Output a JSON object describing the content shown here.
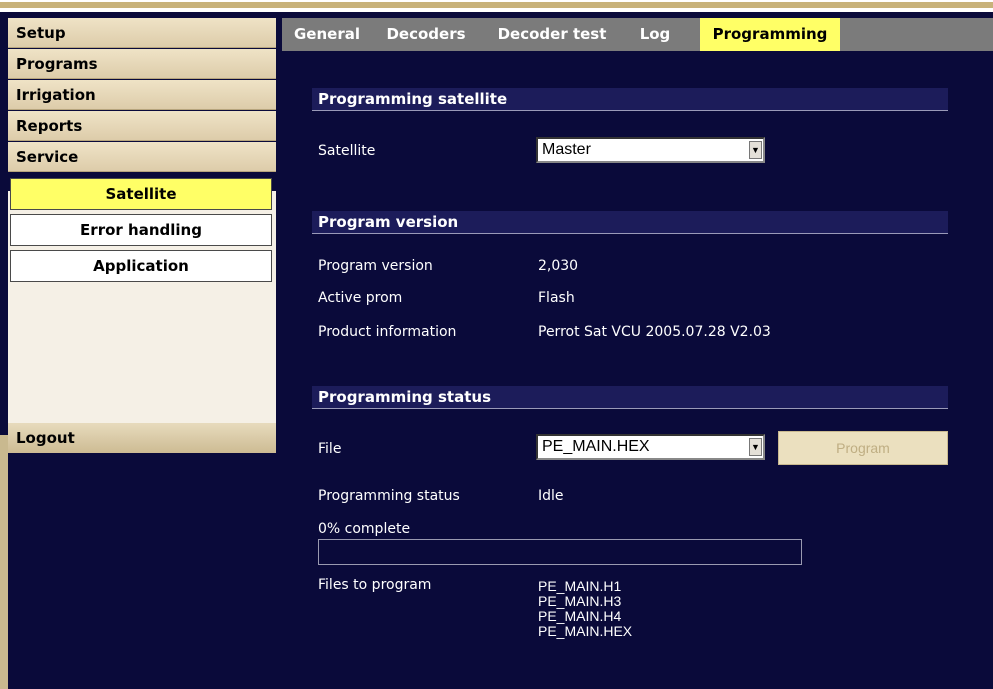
{
  "nav": {
    "main": [
      "Setup",
      "Programs",
      "Irrigation",
      "Reports",
      "Service"
    ],
    "sub": [
      {
        "label": "Satellite",
        "active": true
      },
      {
        "label": "Error handling",
        "active": false
      },
      {
        "label": "Application",
        "active": false
      }
    ],
    "logout": "Logout"
  },
  "tabs": [
    {
      "label": "General",
      "active": false
    },
    {
      "label": "Decoders",
      "active": false
    },
    {
      "label": "Decoder test",
      "active": false
    },
    {
      "label": "Log",
      "active": false
    },
    {
      "label": "Programming",
      "active": true
    }
  ],
  "sections": {
    "satellite": {
      "header": "Programming satellite",
      "label": "Satellite",
      "value": "Master"
    },
    "version": {
      "header": "Program version",
      "rows": [
        {
          "label": "Program version",
          "value": "2,030"
        },
        {
          "label": "Active prom",
          "value": "Flash"
        },
        {
          "label": "Product information",
          "value": "Perrot Sat VCU 2005.07.28 V2.03"
        }
      ]
    },
    "status": {
      "header": "Programming status",
      "file_label": "File",
      "file_value": "PE_MAIN.HEX",
      "program_button": "Program",
      "status_label": "Programming status",
      "status_value": "Idle",
      "progress_text": "0% complete",
      "progress": 0,
      "files_label": "Files to program",
      "files": [
        "PE_MAIN.H1",
        "PE_MAIN.H3",
        "PE_MAIN.H4",
        "PE_MAIN.HEX"
      ]
    }
  },
  "colors": {
    "background": "#0a0a3a",
    "active_highlight": "#ffff66",
    "nav_beige": "#e7dbbd",
    "tab_gray": "#7b7b7b"
  }
}
